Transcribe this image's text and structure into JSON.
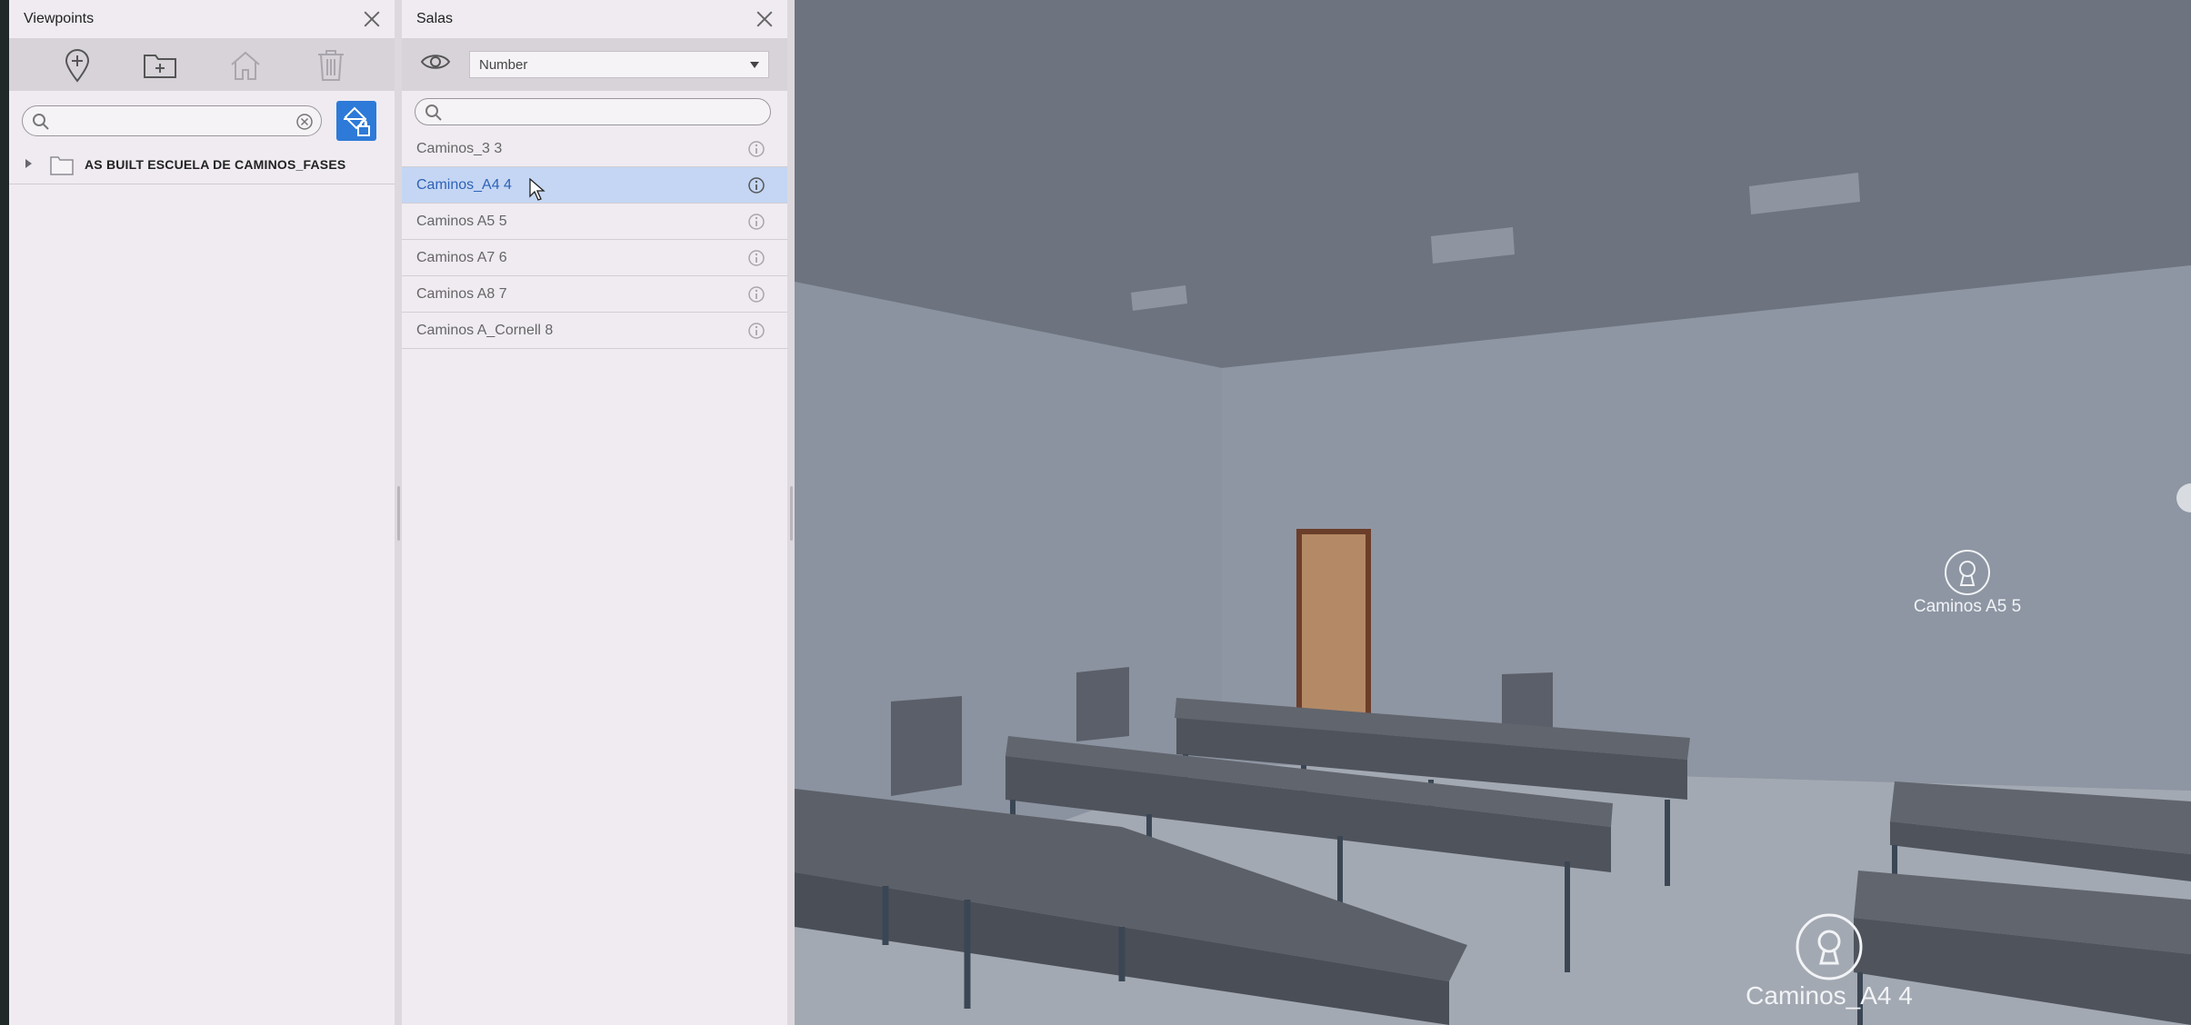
{
  "viewpoints": {
    "title": "Viewpoints",
    "search": {
      "value": "",
      "placeholder": ""
    },
    "toolbar": {
      "add_viewpoint_icon": "location-pin-plus-icon",
      "add_folder_icon": "folder-plus-icon",
      "home_icon": "home-icon",
      "delete_icon": "trash-icon"
    },
    "tree": [
      {
        "label": "AS BUILT ESCUELA DE CAMINOS_FASES",
        "expanded": false
      }
    ]
  },
  "salas": {
    "title": "Salas",
    "sort_select": {
      "value": "Number"
    },
    "search": {
      "value": "",
      "placeholder": ""
    },
    "rooms": [
      {
        "label": "Caminos_3 3",
        "selected": false
      },
      {
        "label": "Caminos_A4 4",
        "selected": true
      },
      {
        "label": "Caminos A5 5",
        "selected": false
      },
      {
        "label": "Caminos A7 6",
        "selected": false
      },
      {
        "label": "Caminos A8 7",
        "selected": false
      },
      {
        "label": "Caminos A_Cornell 8",
        "selected": false
      }
    ]
  },
  "viewport": {
    "markers": [
      {
        "label": "Caminos A5 5"
      },
      {
        "label": "Caminos_A4 4"
      }
    ]
  },
  "colors": {
    "accent": "#2d7ad8",
    "selected_row": "#c4d6f3",
    "selected_text": "#2f62b8",
    "panel_bg": "#efebf1"
  }
}
